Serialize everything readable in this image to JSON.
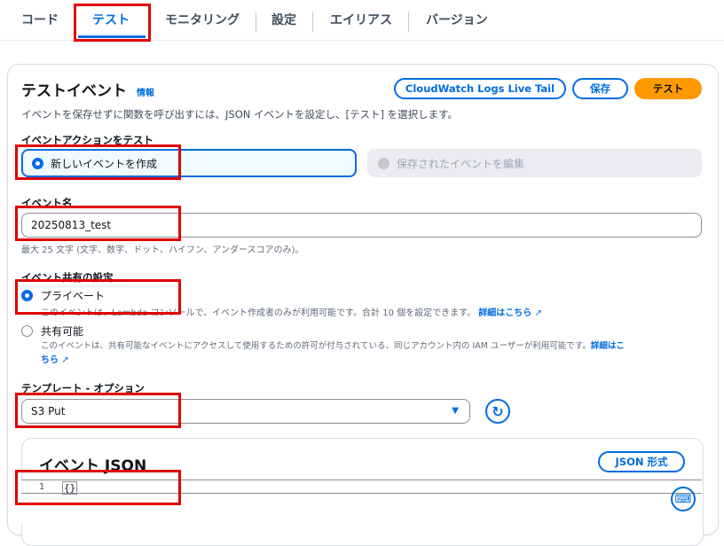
{
  "tabs": [
    {
      "label": "コード"
    },
    {
      "label": "テスト"
    },
    {
      "label": "モニタリング"
    },
    {
      "label": "設定"
    },
    {
      "label": "エイリアス"
    },
    {
      "label": "バージョン"
    }
  ],
  "header": {
    "title": "テストイベント",
    "info_link": "情報",
    "description": "イベントを保存せずに関数を呼び出すには、JSON イベントを設定し、[テスト] を選択します。",
    "buttons": {
      "live_tail": "CloudWatch Logs Live Tail",
      "save": "保存",
      "test": "テスト"
    }
  },
  "event_action": {
    "label": "イベントアクションをテスト",
    "options": [
      {
        "label": "新しいイベントを作成",
        "selected": true
      },
      {
        "label": "保存されたイベントを編集",
        "selected": false,
        "disabled": true
      }
    ]
  },
  "event_name": {
    "label": "イベント名",
    "value": "20250813_test",
    "hint": "最大 25 文字 (文字、数字、ドット、ハイフン、アンダースコアのみ)。"
  },
  "sharing": {
    "label": "イベント共有の設定",
    "private": {
      "label": "プライベート",
      "desc": "このイベントは、Lambda コンソールで、イベント作成者のみが利用可能です。合計 10 個を設定できます。",
      "learn_more": "詳細はこちら"
    },
    "shared": {
      "label": "共有可能",
      "desc_line1": "このイベントは、共有可能なイベントにアクセスして使用するための許可が付与されている、同じアカウント内の IAM ユーザーが利用可能です。",
      "learn_more_part1": "詳細はこ",
      "learn_more_part2": "ちら"
    },
    "selected": "private"
  },
  "template": {
    "label": "テンプレート - オプション",
    "value": "S3 Put"
  },
  "event_json": {
    "title": "イベント JSON",
    "format_button": "JSON 形式",
    "line_number": "1",
    "content": "{}"
  },
  "colors": {
    "accent": "#006ce0",
    "primary_button": "#ff9900",
    "highlight": "#e00000"
  }
}
